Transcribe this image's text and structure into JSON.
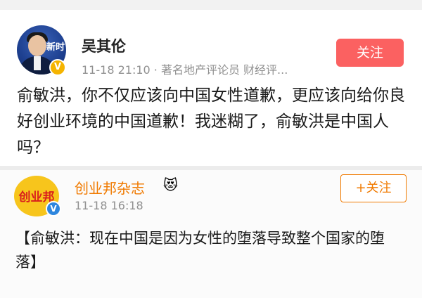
{
  "post1": {
    "author": "吴其伦",
    "avatar_logo": "新时",
    "meta": "11-18 21:10 · 著名地产评论员 财经评...",
    "follow_label": "关注",
    "text": "俞敏洪，你不仅应该向中国女性道歉，更应该向给你良好创业环境的中国道歉！我迷糊了，俞敏洪是中国人吗？",
    "colors": {
      "follow_bg": "#fb6161",
      "verify": "#f5b400"
    }
  },
  "post2": {
    "author": "创业邦杂志",
    "avatar_logo": "创业邦",
    "badge_icon": "crown-face-icon",
    "time": "11-18 16:18",
    "follow_label": "+关注",
    "text": "【俞敏洪：现在中国是因为女性的堕落导致整个国家的堕落】",
    "colors": {
      "name": "#f07a00",
      "follow_border": "#f07a00",
      "verify": "#2e86de"
    }
  }
}
